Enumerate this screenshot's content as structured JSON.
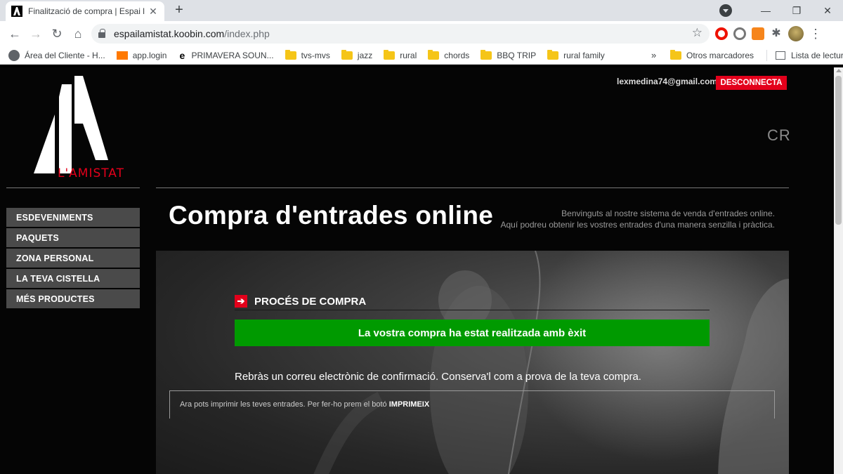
{
  "browser": {
    "tab_title": "Finalització de compra | Espai l'A",
    "url_host": "espailamistat.koobin.com",
    "url_path": "/index.php",
    "bookmarks": [
      {
        "label": "Área del Cliente - H...",
        "icon": "globe-icon"
      },
      {
        "label": "app.login",
        "icon": "orange-square-icon"
      },
      {
        "label": "PRIMAVERA SOUN...",
        "icon": "e-logo-icon"
      },
      {
        "label": "tvs-mvs",
        "icon": "folder-icon"
      },
      {
        "label": "jazz",
        "icon": "folder-icon"
      },
      {
        "label": "rural",
        "icon": "folder-icon"
      },
      {
        "label": "chords",
        "icon": "folder-icon"
      },
      {
        "label": "BBQ TRIP",
        "icon": "folder-icon"
      },
      {
        "label": "rural family",
        "icon": "folder-icon"
      }
    ],
    "bookmarks_more": "»",
    "other_bookmarks": "Otros marcadores",
    "reading_list": "Lista de lectura"
  },
  "site": {
    "logo_text": "L'AMISTAT",
    "user_email": "lexmedina74@gmail.com",
    "logout_label": "DESCONNECTA",
    "language": "CR",
    "nav": [
      "ESDEVENIMENTS",
      "PAQUETS",
      "ZONA PERSONAL",
      "LA TEVA CISTELLA",
      "MÉS PRODUCTES"
    ],
    "page_title": "Compra d'entrades online",
    "welcome_line1": "Benvinguts al nostre sistema de venda d'entrades online.",
    "welcome_line2": "Aquí podreu obtenir les vostres entrades d'una manera senzilla i pràctica.",
    "section_arrow": "➔",
    "section_title": "PROCÉS DE COMPRA",
    "success_message": "La vostra compra ha estat realitzada amb èxit",
    "confirmation_text": "Rebràs un correu electrònic de confirmació. Conserva'l com a prova de la teva compra.",
    "print_text": "Ara pots imprimir les teves entrades. Per fer-ho prem el botó",
    "print_button_word": "IMPRIMEIX"
  },
  "colors": {
    "brand_red": "#e3001b",
    "success_green": "#009a00",
    "nav_bg": "#4a4a4a"
  }
}
